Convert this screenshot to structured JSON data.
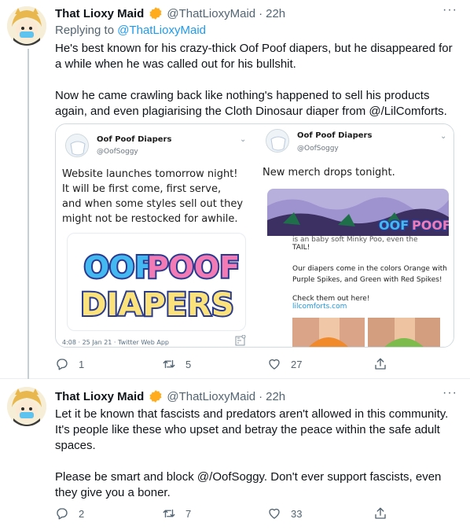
{
  "tweets": [
    {
      "name": "That Lioxy Maid",
      "handle": "@ThatLioxyMaid",
      "dot": "·",
      "time": "22h",
      "replying_label": "Replying to",
      "replying_handle": "@ThatLioxyMaid",
      "text": "He's best known for his crazy-thick Oof Poof diapers, but he disappeared for a while when he was called out for his bullshit.\n\nNow he came crawling back like nothing's happened to sell his products again, and even plagiarising the Cloth Dinosaur diaper from @/LilComforts.",
      "replies": "1",
      "retweets": "5",
      "likes": "27"
    },
    {
      "name": "That Lioxy Maid",
      "handle": "@ThatLioxyMaid",
      "dot": "·",
      "time": "22h",
      "text": "Let it be known that fascists and predators aren't allowed in this community. It's people like these who upset and betray the peace within the safe adult spaces.\n\nPlease be smart and block @/OofSoggy. Don't ever support fascists, even they give you a boner.",
      "replies": "2",
      "retweets": "7",
      "likes": "33"
    }
  ],
  "media": {
    "left": {
      "name": "Oof Poof Diapers",
      "handle": "@OofSoggy",
      "chevron": "⌄",
      "text": "Website launches tomorrow night!\nIt will be first come, first serve,\nand when some styles sell out they\nmight not be restocked for awhile.",
      "logo_line1_a": "OOF",
      "logo_line1_b": "POOF",
      "logo_line2": "DIAPERS",
      "meta": "4:08 · 25 Jan 21 · Twitter Web App"
    },
    "right": {
      "name": "Oof Poof Diapers",
      "handle": "@OofSoggy",
      "chevron": "⌄",
      "text": "New merch drops tonight.",
      "banner_a": "OOF",
      "banner_b": "POOF",
      "cut_line": "is an baby soft Minky Poo, even the",
      "tail": "TAIL!",
      "colors_text": "Our diapers come in the colors Orange with\nPurple Spikes, and Green with Red Spikes!",
      "check": "Check them out here!",
      "link": "lilcomforts.com"
    }
  },
  "colors": {
    "accent": "#1d9bf0",
    "verified": "#ffad1f",
    "muted": "#536471",
    "logo_blue": "#44b8f0",
    "logo_pink": "#f27bb5",
    "logo_yellow": "#fbe27a",
    "logo_outline": "#2a3b8f"
  },
  "icons": [
    "more-icon",
    "verified-badge-icon",
    "reply-icon",
    "retweet-icon",
    "like-icon",
    "share-icon"
  ]
}
